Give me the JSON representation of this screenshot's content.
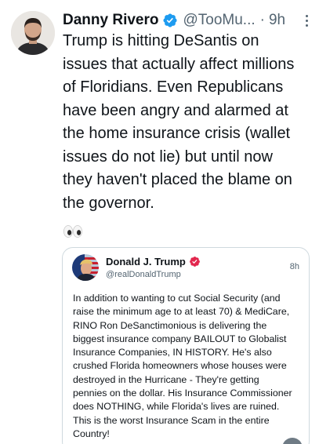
{
  "tweet": {
    "author": {
      "name": "Danny Rivero",
      "handle": "@TooMu...",
      "verified": true
    },
    "time": "9h",
    "text": "Trump is hitting DeSantis on\nissues that actually affect millions\nof Floridians. Even Republicans\nhave been angry and alarmed at\nthe home insurance crisis (wallet\nissues do not lie) but until now\nthey haven't placed the blame on\nthe governor.",
    "emoji": "eyes",
    "icons": {
      "verified": "verified-badge-icon",
      "more": "more-options-icon"
    },
    "colors": {
      "text": "#0f1419",
      "secondary": "#536471",
      "verified": "#1d9bf0",
      "border": "#cfd9de"
    }
  },
  "quoted_post": {
    "author": {
      "name": "Donald J. Trump",
      "handle": "@realDonaldTrump",
      "verified_color": "#e2264d"
    },
    "time": "8h",
    "text": "In addition to wanting to cut Social Security (and\nraise the minimum age to at least 70) & MediCare,\nRINO Ron DeSanctimonious is delivering the\nbiggest insurance company BAILOUT to Globalist\nInsurance Companies, IN HISTORY. He's also\ncrushed Florida homeowners whose houses were\ndestroyed in the Hurricane - They're getting\npennies on the dollar. His Insurance Commissioner\ndoes NOTHING, while Florida's lives are ruined.\nThis is the worst Insurance Scam in the entire\nCountry!"
  }
}
